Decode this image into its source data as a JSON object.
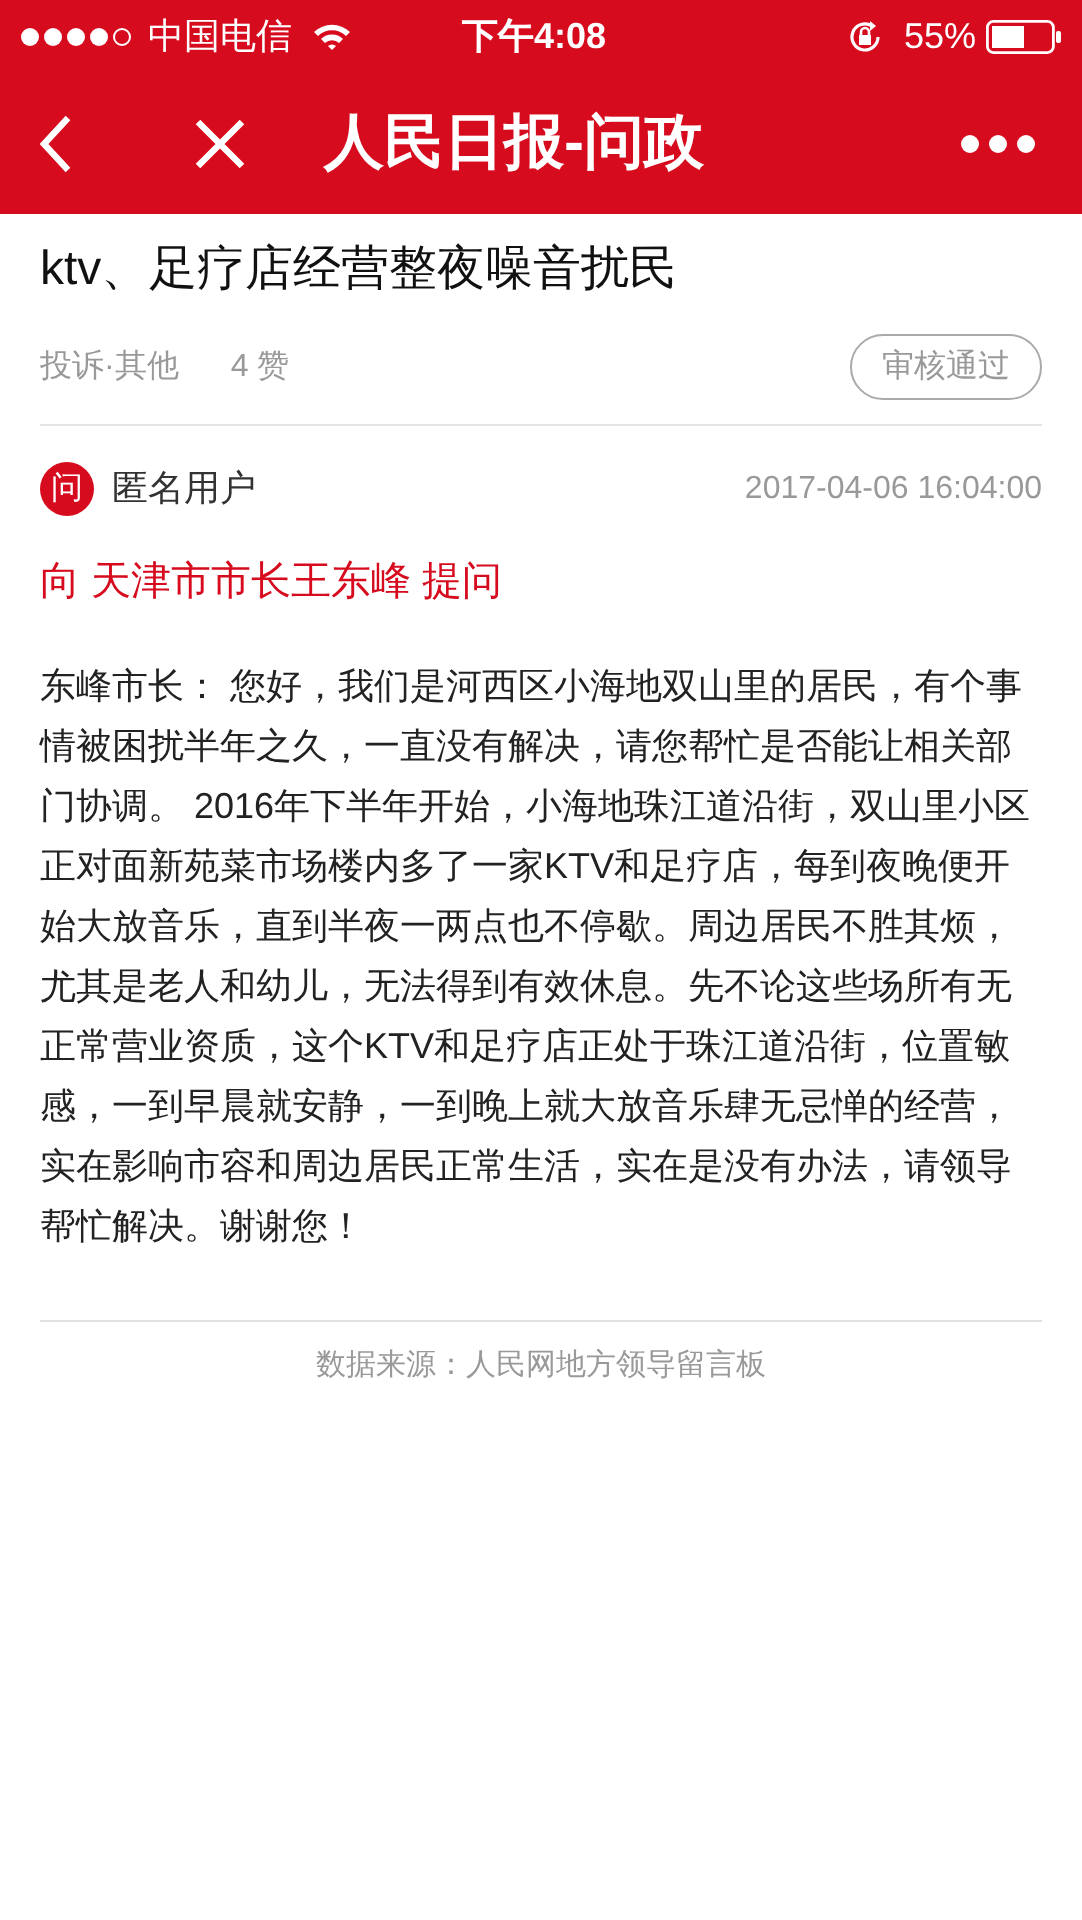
{
  "status_bar": {
    "carrier": "中国电信",
    "time": "下午4:08",
    "battery": "55%"
  },
  "nav_bar": {
    "title": "人民日报-问政"
  },
  "post": {
    "title": "ktv、足疗店经营整夜噪音扰民",
    "category": "投诉·其他",
    "likes": "4 赞",
    "status_badge": "审核通过",
    "author_icon": "问",
    "author": "匿名用户",
    "datetime": "2017-04-06 16:04:00",
    "addressee": "向 天津市市长王东峰 提问",
    "body": "东峰市长： 您好，我们是河西区小海地双山里的居民，有个事情被困扰半年之久，一直没有解决，请您帮忙是否能让相关部门协调。 2016年下半年开始，小海地珠江道沿街，双山里小区正对面新苑菜市场楼内多了一家KTV和足疗店，每到夜晚便开始大放音乐，直到半夜一两点也不停歇。周边居民不胜其烦，尤其是老人和幼儿，无法得到有效休息。先不论这些场所有无正常营业资质，这个KTV和足疗店正处于珠江道沿街，位置敏感，一到早晨就安静，一到晚上就大放音乐肆无忌惮的经营，实在影响市容和周边居民正常生活，实在是没有办法，请领导帮忙解决。谢谢您！",
    "source": "数据来源：人民网地方领导留言板"
  }
}
